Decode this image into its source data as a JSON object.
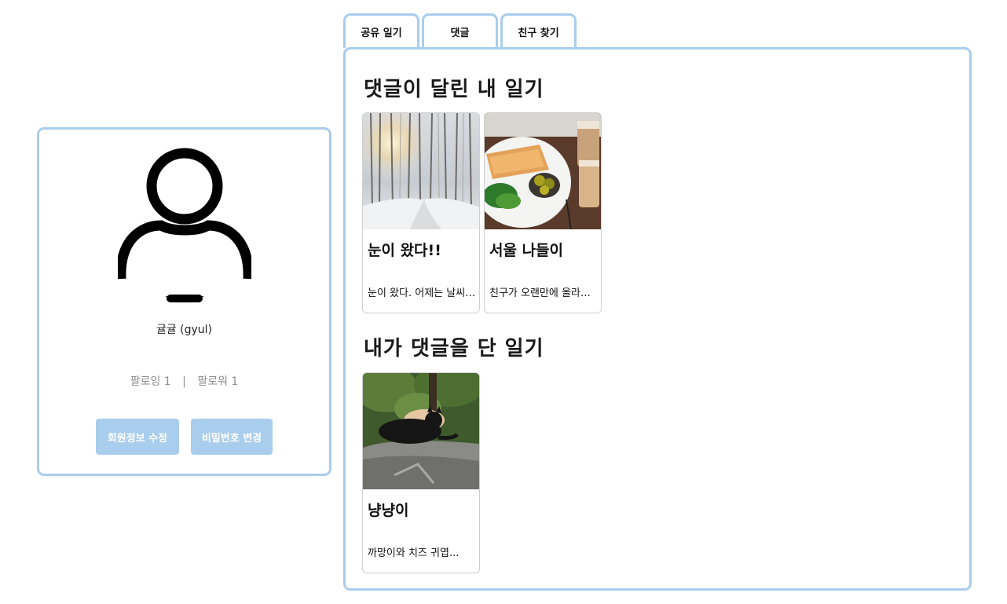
{
  "profile": {
    "name": "귤귤 (gyul)",
    "following_label": "팔로잉 1",
    "separator": "|",
    "followers_label": "팔로워 1",
    "edit_profile_button": "회원정보 수정",
    "change_password_button": "비밀번호 변경",
    "avatar_icon": "user-icon"
  },
  "tabs": [
    {
      "label": "공유 일기"
    },
    {
      "label": "댓글"
    },
    {
      "label": "친구 찾기"
    }
  ],
  "sections": {
    "commented_on_mine": {
      "title": "댓글이 달린 내 일기",
      "cards": [
        {
          "title": "눈이 왔다!!",
          "excerpt": "눈이 왔다. 어제는 날씨가...",
          "image": "snowy-forest-photo"
        },
        {
          "title": "서울 나들이",
          "excerpt": "친구가 오랜만에 올라와서...",
          "image": "food-tray-photo"
        }
      ]
    },
    "my_comments": {
      "title": "내가 댓글을 단 일기",
      "cards": [
        {
          "title": "냥냥이",
          "excerpt": "까망이와 치즈 귀엽...",
          "image": "cats-on-rock-photo"
        }
      ]
    }
  },
  "colors": {
    "accent": "#a9cdec",
    "muted_text": "#8c8c8c"
  }
}
